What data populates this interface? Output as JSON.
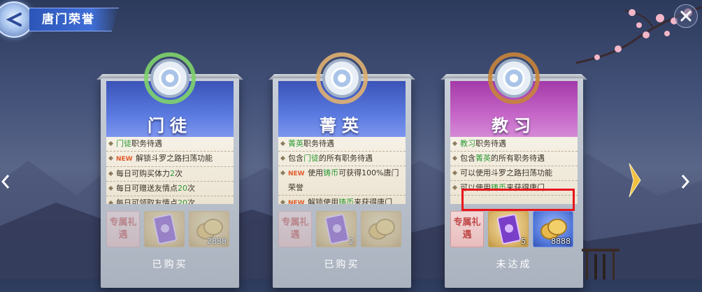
{
  "header": {
    "title": "唐门荣誉"
  },
  "cards": [
    {
      "name": "门徒",
      "theme": "blue",
      "perks": [
        {
          "new": "",
          "pre": "",
          "hl": "门徒",
          "post": "职务待遇"
        },
        {
          "new": "NEW",
          "pre": "解锁斗罗之路扫荡功能",
          "hl": "",
          "post": ""
        },
        {
          "new": "",
          "pre": "每日可购买体力",
          "hl": "2",
          "post": "次"
        },
        {
          "new": "",
          "pre": "每日可赠送友情点",
          "hl": "20",
          "post": "次"
        },
        {
          "new": "",
          "pre": "每日可领取友情点",
          "hl": "20",
          "post": "次"
        }
      ],
      "gift_tag": "专属礼遇",
      "rewards": [
        {
          "icon": "purple-ticket-icon",
          "qty": ""
        },
        {
          "icon": "gold-coins-icon",
          "qty": "2888"
        }
      ],
      "status": "已购买"
    },
    {
      "name": "菁英",
      "theme": "blue",
      "perks": [
        {
          "new": "",
          "pre": "",
          "hl": "菁英",
          "post": "职务待遇"
        },
        {
          "new": "",
          "pre": "包含",
          "hl": "门徒",
          "post": "的所有职务待遇"
        },
        {
          "new": "NEW",
          "pre": "使用",
          "hl": "铸币",
          "post": "可获得100%唐门荣誉",
          "hl2": "100%"
        },
        {
          "new": "NEW",
          "pre": "解锁使用",
          "hl": "铸币",
          "post": "来获得唐门"
        }
      ],
      "gift_tag": "专属礼遇",
      "rewards": [
        {
          "icon": "purple-ticket-icon",
          "qty": "2"
        },
        {
          "icon": "gold-coins-icon",
          "qty": ""
        }
      ],
      "status": "已购买"
    },
    {
      "name": "教习",
      "theme": "purple",
      "perks": [
        {
          "new": "",
          "pre": "",
          "hl": "教习",
          "post": "职务待遇"
        },
        {
          "new": "",
          "pre": "包含",
          "hl": "菁英",
          "post": "的所有职务待遇"
        },
        {
          "new": "",
          "pre": "可以使用斗罗之路扫荡功能",
          "hl": "",
          "post": ""
        },
        {
          "new": "",
          "pre": "可以使用",
          "hl": "铸币",
          "post": "来获得唐门"
        }
      ],
      "gift_tag": "专属礼遇",
      "rewards": [
        {
          "icon": "purple-ticket-icon",
          "qty": "5"
        },
        {
          "icon": "gold-coins-icon",
          "qty": "8888"
        }
      ],
      "status": "未达成"
    }
  ],
  "colors": {
    "highlight_green": "#2e9a36",
    "new_orange": "#e25a2a",
    "annotation_red": "#e8141c"
  }
}
